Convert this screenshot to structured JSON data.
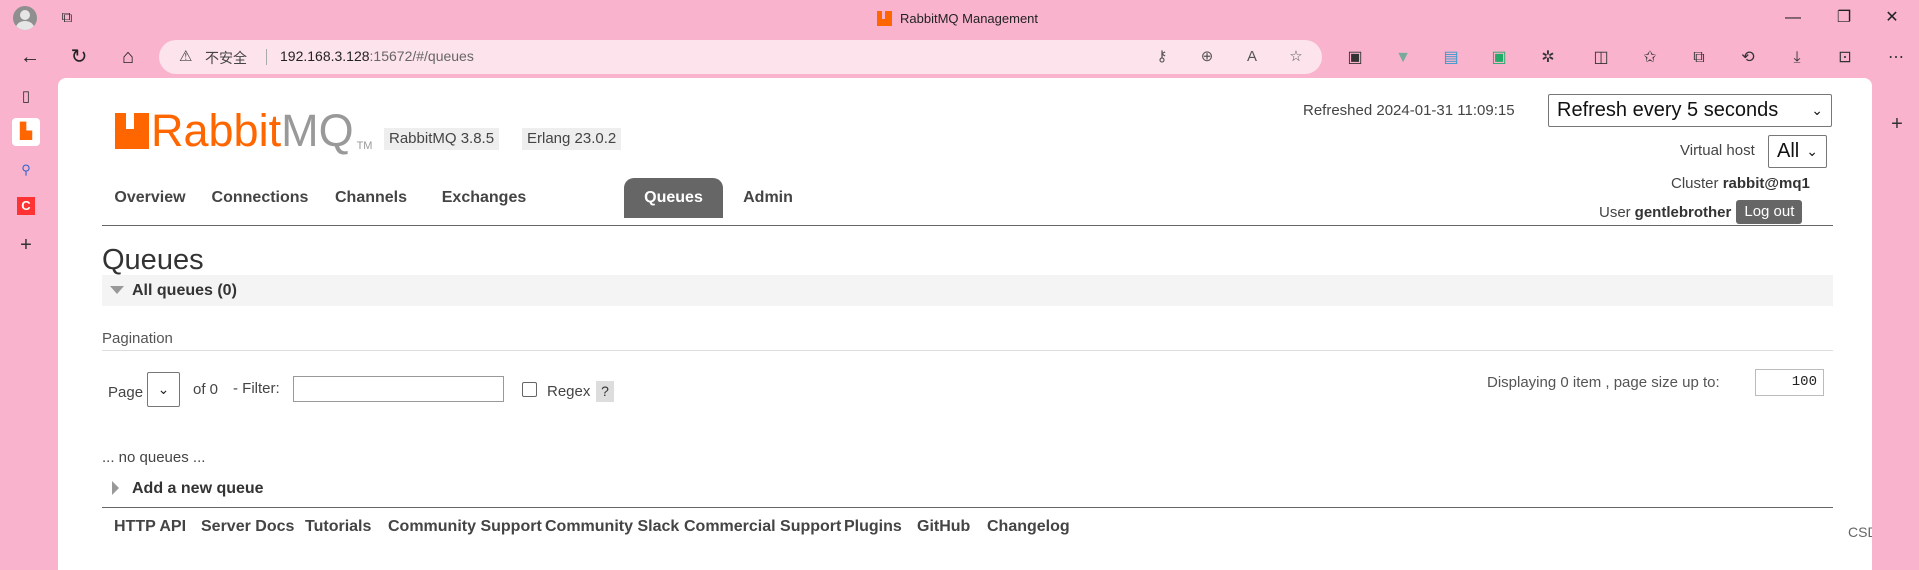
{
  "browser": {
    "tab_title": "RabbitMQ Management",
    "security_label": "不安全",
    "url_host": "192.168.3.128",
    "url_rest": ":15672/#/queues",
    "window_controls": {
      "minimize": "—",
      "restore": "❐",
      "close": "✕"
    }
  },
  "header": {
    "logo_rabbit": "Rabbit",
    "logo_mq": "MQ",
    "logo_tm": "TM",
    "rabbitmq_version": "RabbitMQ 3.8.5",
    "erlang_version": "Erlang 23.0.2",
    "refreshed": "Refreshed 2024-01-31 11:09:15",
    "refresh_select": "Refresh every 5 seconds",
    "virtual_host_label": "Virtual host",
    "virtual_host_value": "All",
    "cluster_label": "Cluster",
    "cluster_value": "rabbit@mq1",
    "user_label": "User",
    "user_value": "gentlebrother",
    "logout_label": "Log out"
  },
  "nav": {
    "tabs": [
      {
        "label": "Overview"
      },
      {
        "label": "Connections"
      },
      {
        "label": "Channels"
      },
      {
        "label": "Exchanges"
      },
      {
        "label": "Queues"
      },
      {
        "label": "Admin"
      }
    ],
    "active": "Queues"
  },
  "main": {
    "heading": "Queues",
    "all_queues": "All queues (0)",
    "pagination_label": "Pagination",
    "page_label": "Page",
    "of_label": "of 0",
    "filter_label": "- Filter:",
    "filter_value": "",
    "regex_label": "Regex",
    "help_label": "?",
    "displaying_label": "Displaying 0 item , page size up to:",
    "page_size_value": "100",
    "no_queues": "... no queues ...",
    "add_queue": "Add a new queue"
  },
  "footer": {
    "links": [
      {
        "label": "HTTP API"
      },
      {
        "label": "Server Docs"
      },
      {
        "label": "Tutorials"
      },
      {
        "label": "Community Support"
      },
      {
        "label": "Community Slack"
      },
      {
        "label": "Commercial Support"
      },
      {
        "label": "Plugins"
      },
      {
        "label": "GitHub"
      },
      {
        "label": "Changelog"
      }
    ]
  },
  "watermark": "CSDN @温柔哥`",
  "colors": {
    "browser_background": "#f9b3cd",
    "rabbitmq_orange": "#ff6600",
    "active_tab": "#666666"
  }
}
